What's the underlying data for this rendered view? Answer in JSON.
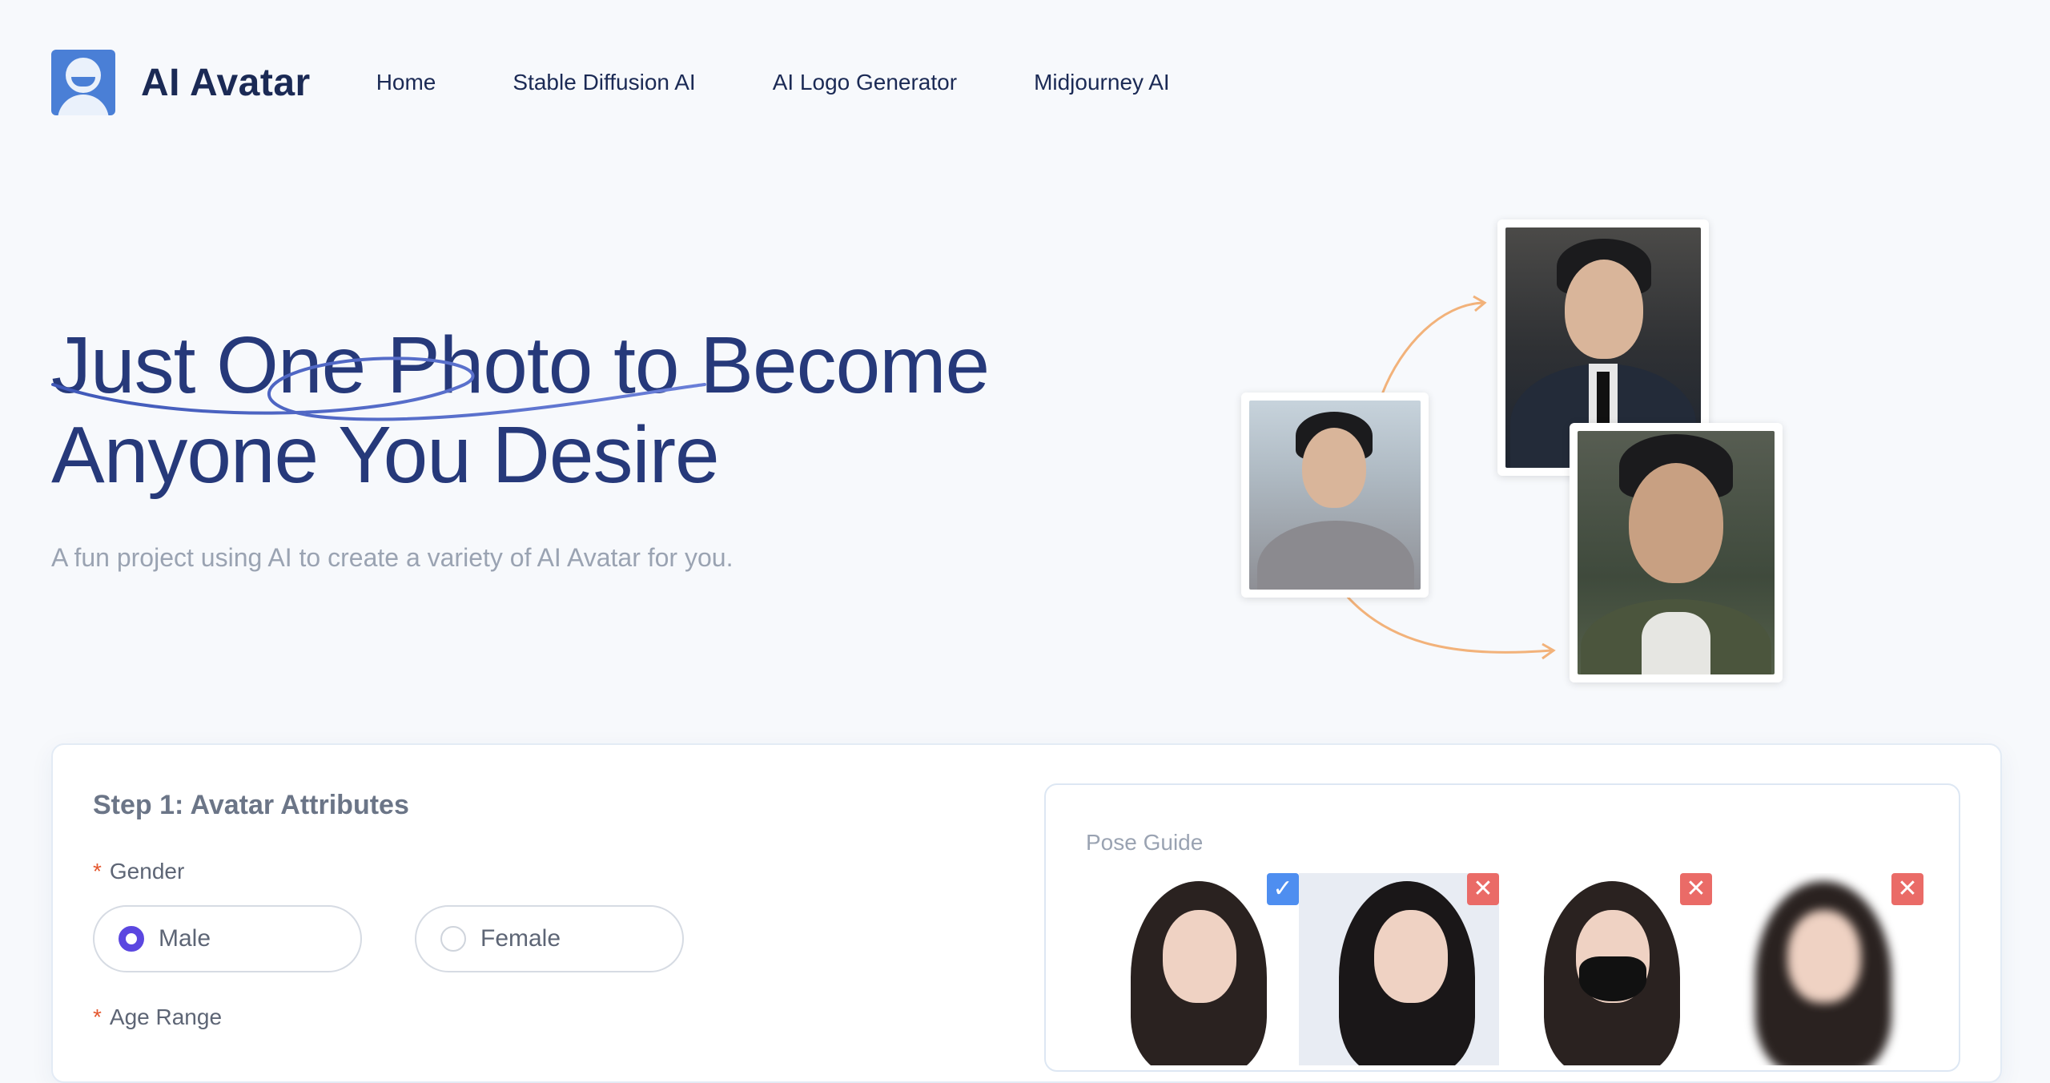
{
  "header": {
    "brand": "AI Avatar",
    "nav": [
      "Home",
      "Stable Diffusion AI",
      "AI Logo Generator",
      "Midjourney AI"
    ]
  },
  "hero": {
    "title_line1": "Just One Photo to Become",
    "title_line2": "Anyone You Desire",
    "subtitle": "A fun project using AI to create a variety of AI Avatar for you."
  },
  "form": {
    "step_title": "Step 1: Avatar Attributes",
    "gender": {
      "label": "Gender",
      "required_mark": "*",
      "options": [
        "Male",
        "Female"
      ],
      "selected": "Male"
    },
    "age_range": {
      "label": "Age Range",
      "required_mark": "*"
    }
  },
  "pose_guide": {
    "title": "Pose Guide",
    "examples": [
      {
        "status": "ok",
        "icon": "check-icon"
      },
      {
        "status": "bad",
        "icon": "close-icon"
      },
      {
        "status": "bad",
        "icon": "close-icon"
      },
      {
        "status": "bad",
        "icon": "close-icon"
      }
    ]
  },
  "colors": {
    "accent": "#5b47e0",
    "title": "#26397a",
    "ok_badge": "#4e8ef0",
    "bad_badge": "#ea6b67",
    "arrow": "#f2b27a"
  }
}
